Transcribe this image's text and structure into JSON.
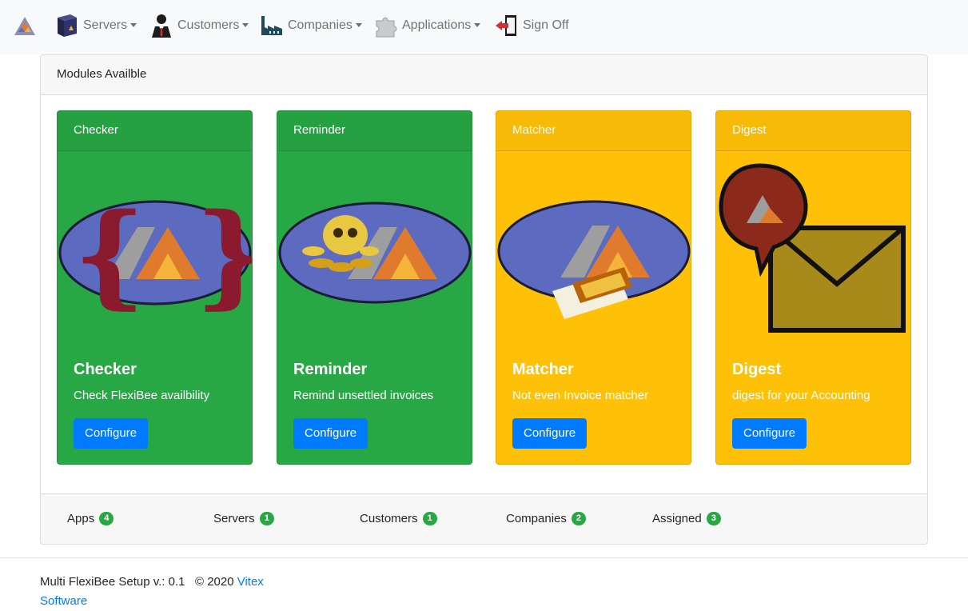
{
  "navbar": {
    "brand_icon": "app-logo-icon",
    "items": [
      {
        "label": "Servers",
        "icon": "server-box-icon",
        "dropdown": true
      },
      {
        "label": "Customers",
        "icon": "businessman-icon",
        "dropdown": true
      },
      {
        "label": "Companies",
        "icon": "factory-icon",
        "dropdown": true
      },
      {
        "label": "Applications",
        "icon": "puzzle-piece-icon",
        "dropdown": true
      },
      {
        "label": "Sign Off",
        "icon": "exit-door-icon",
        "dropdown": false
      }
    ]
  },
  "panel": {
    "title": "Modules Availble",
    "modules": [
      {
        "header": "Checker",
        "title": "Checker",
        "text": "Check FlexiBee availbility",
        "button": "Configure",
        "color": "#28a745",
        "icon": "braces-logo-icon"
      },
      {
        "header": "Reminder",
        "title": "Reminder",
        "text": "Remind unsettled invoices",
        "button": "Configure",
        "color": "#28a745",
        "icon": "skull-coins-logo-icon"
      },
      {
        "header": "Matcher",
        "title": "Matcher",
        "text": "Not even Invoice matcher",
        "button": "Configure",
        "color": "#ffc107",
        "icon": "matchbox-logo-icon"
      },
      {
        "header": "Digest",
        "title": "Digest",
        "text": "digest for your Accounting",
        "button": "Configure",
        "color": "#ffc107",
        "icon": "envelope-bubble-icon"
      }
    ],
    "stats": [
      {
        "label": "Apps",
        "count": "4"
      },
      {
        "label": "Servers",
        "count": "1"
      },
      {
        "label": "Customers",
        "count": "1"
      },
      {
        "label": "Companies",
        "count": "2"
      },
      {
        "label": "Assigned",
        "count": "3"
      }
    ]
  },
  "footer": {
    "text": "Multi FlexiBee Setup v.: 0.1   © 2020 ",
    "link": "Vitex Software"
  },
  "colors": {
    "primary": "#007bff",
    "success": "#28a745",
    "warning": "#ffc107"
  }
}
